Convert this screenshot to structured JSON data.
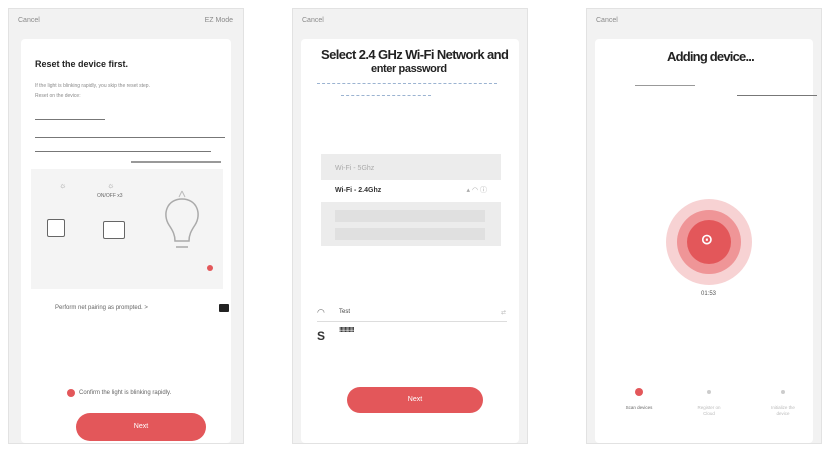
{
  "screen1": {
    "cancel": "Cancel",
    "mode": "EZ Mode",
    "title": "Reset the device first.",
    "hint1": "If the light is blinking rapidly, you skip the reset step.",
    "hint2": "Reset on the device:",
    "status_text": "ON/OFF x3",
    "prompt": "Perform net pairing as prompted.",
    "prompt_arrow": ">",
    "confirm": "Confirm the light is blinking rapidly.",
    "next": "Next"
  },
  "screen2": {
    "cancel": "Cancel",
    "title_line1": "Select 2.4 GHz Wi-Fi Network and",
    "title_line2": "enter password",
    "wifi_list": [
      {
        "label": "Wi-Fi - 5Ghz",
        "active": false
      },
      {
        "label": "Wi-Fi - 2.4Ghz",
        "active": true
      }
    ],
    "network_name": "Test",
    "password_text": "!!!!!!!!!!!",
    "password_prefix": "S",
    "next": "Next"
  },
  "screen3": {
    "cancel": "Cancel",
    "title": "Adding device...",
    "timer": "01:53",
    "steps": [
      {
        "label": "Scan devices",
        "active": true
      },
      {
        "label": "Register on Cloud",
        "active": false
      },
      {
        "label": "Initialize the device",
        "active": false
      }
    ]
  }
}
